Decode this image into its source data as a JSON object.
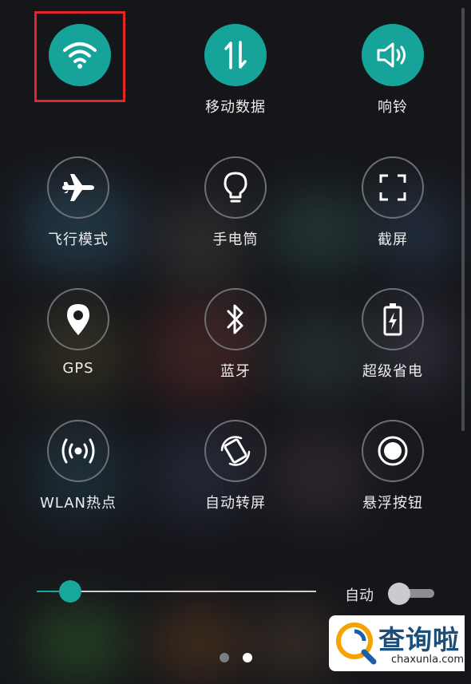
{
  "quick_settings": {
    "tiles": [
      {
        "id": "wifi",
        "label": "",
        "icon": "wifi-icon",
        "active": true
      },
      {
        "id": "mobile-data",
        "label": "移动数据",
        "icon": "mobile-data-arrows-icon",
        "active": true
      },
      {
        "id": "ringer",
        "label": "响铃",
        "icon": "speaker-icon",
        "active": true
      },
      {
        "id": "airplane",
        "label": "飞行模式",
        "icon": "airplane-icon",
        "active": false
      },
      {
        "id": "flashlight",
        "label": "手电筒",
        "icon": "lightbulb-icon",
        "active": false
      },
      {
        "id": "screenshot",
        "label": "截屏",
        "icon": "screenshot-frame-icon",
        "active": false
      },
      {
        "id": "gps",
        "label": "GPS",
        "icon": "location-pin-icon",
        "active": false
      },
      {
        "id": "bluetooth",
        "label": "蓝牙",
        "icon": "bluetooth-icon",
        "active": false
      },
      {
        "id": "power-saver",
        "label": "超级省电",
        "icon": "battery-bolt-icon",
        "active": false
      },
      {
        "id": "hotspot",
        "label": "WLAN热点",
        "icon": "hotspot-icon",
        "active": false
      },
      {
        "id": "auto-rotate",
        "label": "自动转屏",
        "icon": "rotate-icon",
        "active": false
      },
      {
        "id": "floating-button",
        "label": "悬浮按钮",
        "icon": "floating-button-icon",
        "active": false
      }
    ]
  },
  "brightness": {
    "level": 0.12,
    "auto_label": "自动",
    "auto_enabled": false
  },
  "pager": {
    "pages": 2,
    "current": 2
  },
  "watermark": {
    "title": "查询啦",
    "url": "chaxunla.com"
  },
  "colors": {
    "accent": "#16a39a",
    "highlight_box": "#e32626",
    "inactive_ring": "#6e7076"
  }
}
